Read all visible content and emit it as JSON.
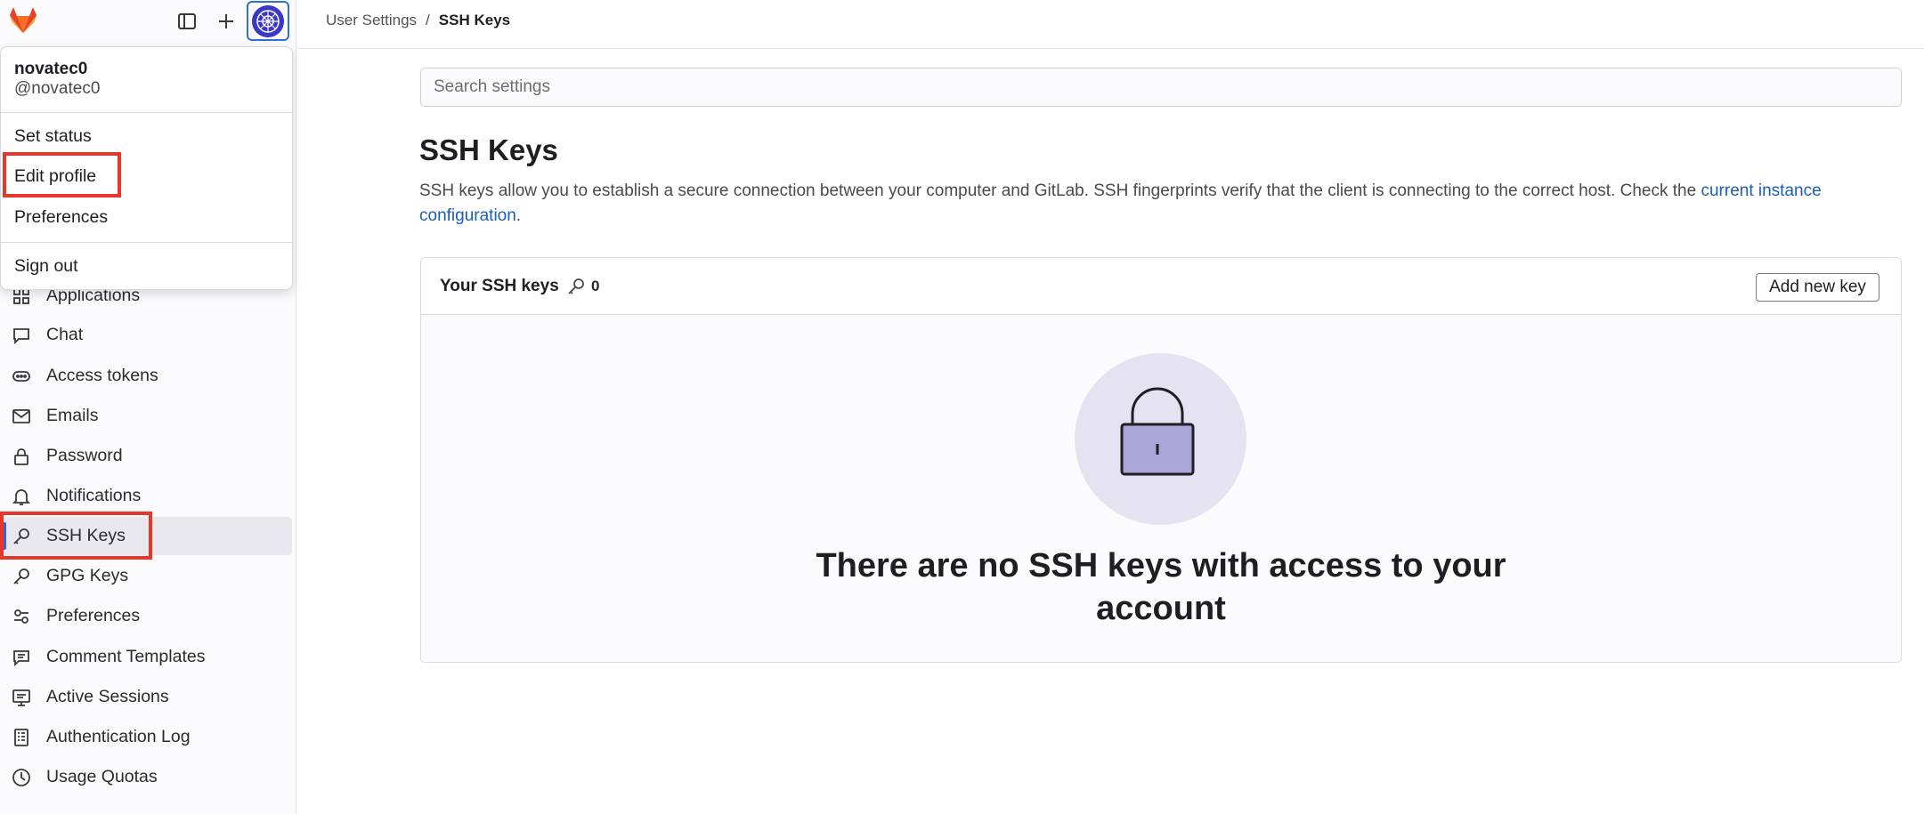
{
  "header": {
    "breadcrumb": [
      "User Settings",
      "SSH Keys"
    ],
    "separator": "/"
  },
  "topbar": {
    "icons": [
      "gitlab-logo",
      "sidebar-toggle-icon",
      "plus-icon",
      "avatar"
    ]
  },
  "user_menu": {
    "name": "novatec0",
    "handle": "@novatec0",
    "items": [
      "Set status",
      "Edit profile",
      "Preferences"
    ],
    "sign_out": "Sign out"
  },
  "sidebar": {
    "items": [
      {
        "label": "Applications",
        "icon": "applications-icon"
      },
      {
        "label": "Chat",
        "icon": "chat-icon"
      },
      {
        "label": "Access tokens",
        "icon": "token-icon"
      },
      {
        "label": "Emails",
        "icon": "mail-icon"
      },
      {
        "label": "Password",
        "icon": "lock-icon"
      },
      {
        "label": "Notifications",
        "icon": "bell-icon"
      },
      {
        "label": "SSH Keys",
        "icon": "key-icon",
        "active": true
      },
      {
        "label": "GPG Keys",
        "icon": "key-icon"
      },
      {
        "label": "Preferences",
        "icon": "preferences-icon"
      },
      {
        "label": "Comment Templates",
        "icon": "comment-icon"
      },
      {
        "label": "Active Sessions",
        "icon": "monitor-icon"
      },
      {
        "label": "Authentication Log",
        "icon": "log-icon"
      },
      {
        "label": "Usage Quotas",
        "icon": "quota-icon"
      }
    ]
  },
  "main": {
    "search_placeholder": "Search settings",
    "title": "SSH Keys",
    "description": "SSH keys allow you to establish a secure connection between your computer and GitLab. SSH fingerprints verify that the client is connecting to the correct host. Check the ",
    "description_link": "current instance configuration",
    "description_end": ".",
    "card": {
      "title": "Your SSH keys",
      "count": "0",
      "add_button": "Add new key",
      "empty_message": "There are no SSH keys with access to your account"
    }
  },
  "colors": {
    "accent": "#3763d6",
    "highlight": "#e8372a",
    "link": "#1a5fb4",
    "empty_circle": "#e5e2f2",
    "lock_fill": "#aba5d8"
  }
}
